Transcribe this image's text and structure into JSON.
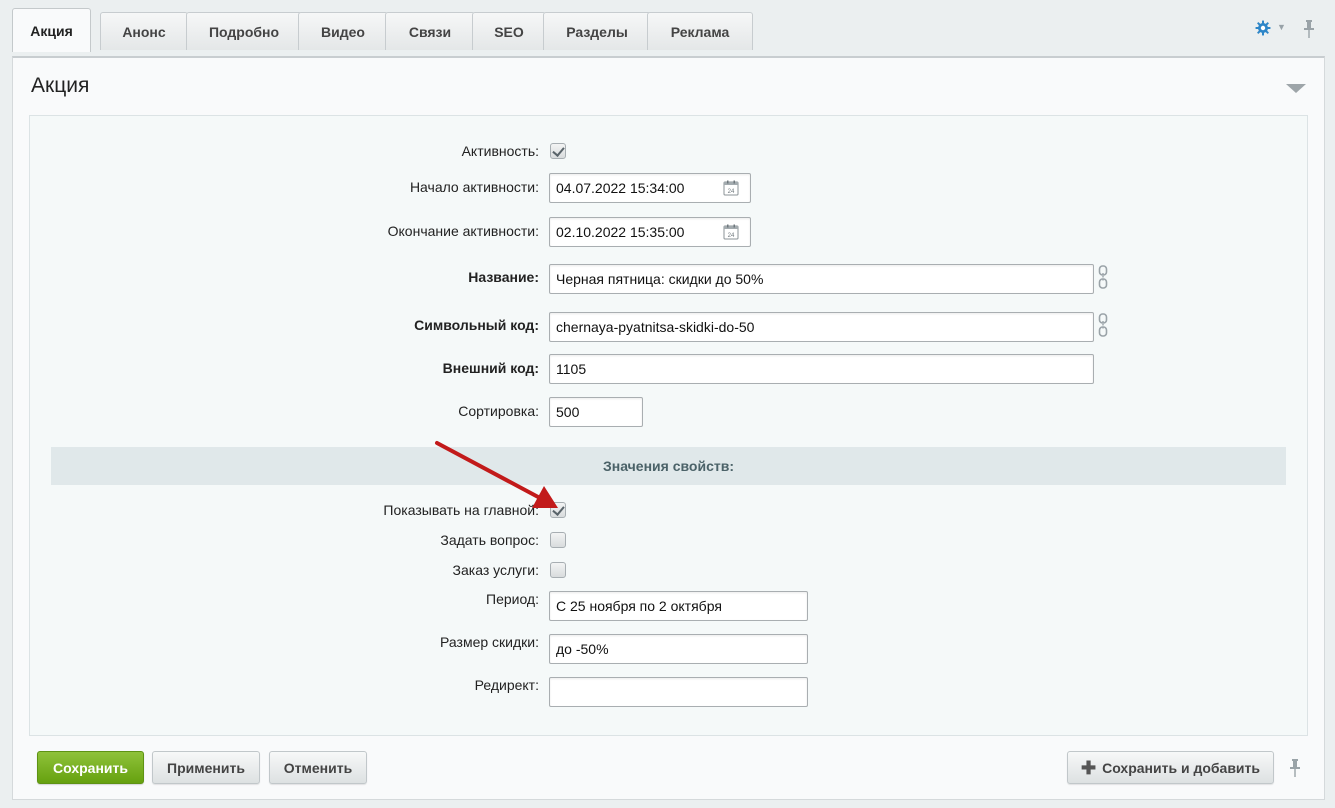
{
  "tabs": [
    {
      "label": "Акция",
      "active": true
    },
    {
      "label": "Анонс"
    },
    {
      "label": "Подробно"
    },
    {
      "label": "Видео"
    },
    {
      "label": "Связи"
    },
    {
      "label": "SEO"
    },
    {
      "label": "Разделы"
    },
    {
      "label": "Реклама"
    }
  ],
  "panel": {
    "title": "Акция"
  },
  "form": {
    "active_label": "Активность:",
    "active_checked": true,
    "start_label": "Начало активности:",
    "start_value": "04.07.2022 15:34:00",
    "end_label": "Окончание активности:",
    "end_value": "02.10.2022 15:35:00",
    "name_label": "Название:",
    "name_value": "Черная пятница: скидки до 50%",
    "code_label": "Символьный код:",
    "code_value": "chernaya-pyatnitsa-skidki-do-50",
    "ext_label": "Внешний код:",
    "ext_value": "1105",
    "sort_label": "Сортировка:",
    "sort_value": "500"
  },
  "properties": {
    "section_title": "Значения свойств:",
    "show_main_label": "Показывать на главной:",
    "show_main_checked": true,
    "ask_label": "Задать вопрос:",
    "ask_checked": false,
    "order_label": "Заказ услуги:",
    "order_checked": false,
    "period_label": "Период:",
    "period_value": "С 25 ноября по 2 октября",
    "discount_label": "Размер скидки:",
    "discount_value": "до -50%",
    "redirect_label": "Редирект:",
    "redirect_value": ""
  },
  "footer": {
    "save_label": "Сохранить",
    "apply_label": "Применить",
    "cancel_label": "Отменить",
    "save_add_label": "Сохранить и добавить"
  },
  "colors": {
    "accent_green": "#6ba415",
    "arrow_red": "#c21a1a",
    "gear_blue": "#2d86c8"
  },
  "icons": [
    "gear-icon",
    "pin-icon",
    "calendar-icon",
    "link-icon",
    "chevron-down-icon",
    "plus-icon"
  ]
}
